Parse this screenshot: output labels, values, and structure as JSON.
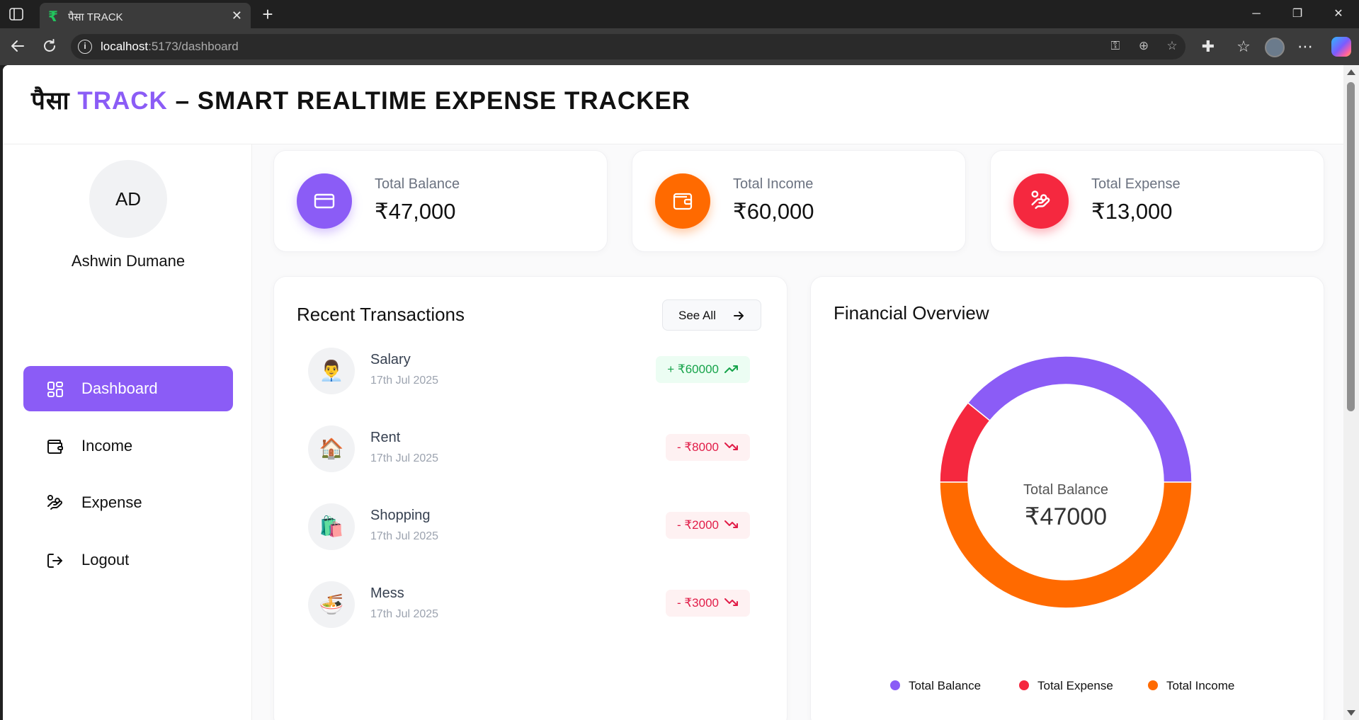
{
  "browser": {
    "tab_title": "पैसा TRACK",
    "tab_favicon": "₹",
    "url_host": "localhost",
    "url_rest": ":5173/dashboard"
  },
  "header": {
    "brand_prefix": "पैसा",
    "brand_accent": "TRACK",
    "brand_suffix": "– SMART REALTIME EXPENSE TRACKER"
  },
  "sidebar": {
    "initials": "AD",
    "user_name": "Ashwin Dumane",
    "items": [
      {
        "label": "Dashboard",
        "icon": "dashboard-icon",
        "active": true
      },
      {
        "label": "Income",
        "icon": "wallet-icon",
        "active": false
      },
      {
        "label": "Expense",
        "icon": "hand-coins-icon",
        "active": false
      },
      {
        "label": "Logout",
        "icon": "logout-icon",
        "active": false
      }
    ]
  },
  "stats": [
    {
      "label": "Total Balance",
      "value": "₹47,000",
      "color": "#8b5cf6",
      "icon": "card-icon"
    },
    {
      "label": "Total Income",
      "value": "₹60,000",
      "color": "#ff6a00",
      "icon": "wallet-icon"
    },
    {
      "label": "Total Expense",
      "value": "₹13,000",
      "color": "#f5283f",
      "icon": "hand-coins-icon"
    }
  ],
  "transactions": {
    "title": "Recent Transactions",
    "see_all": "See All",
    "items": [
      {
        "icon": "👨‍💼",
        "name": "Salary",
        "date": "17th Jul 2025",
        "amount": "+ ₹60000",
        "type": "income"
      },
      {
        "icon": "🏠",
        "name": "Rent",
        "date": "17th Jul 2025",
        "amount": "- ₹8000",
        "type": "expense"
      },
      {
        "icon": "🛍️",
        "name": "Shopping",
        "date": "17th Jul 2025",
        "amount": "- ₹2000",
        "type": "expense"
      },
      {
        "icon": "🍜",
        "name": "Mess",
        "date": "17th Jul 2025",
        "amount": "- ₹3000",
        "type": "expense"
      }
    ]
  },
  "overview": {
    "title": "Financial Overview",
    "center_label": "Total Balance",
    "center_value": "₹47000"
  },
  "chart_data": {
    "type": "pie",
    "categories": [
      "Total Balance",
      "Total Expense",
      "Total Income"
    ],
    "values": [
      47000,
      13000,
      60000
    ],
    "colors": [
      "#8b5cf6",
      "#f5283f",
      "#ff6a00"
    ],
    "title": "Financial Overview",
    "legend": "bottom"
  }
}
